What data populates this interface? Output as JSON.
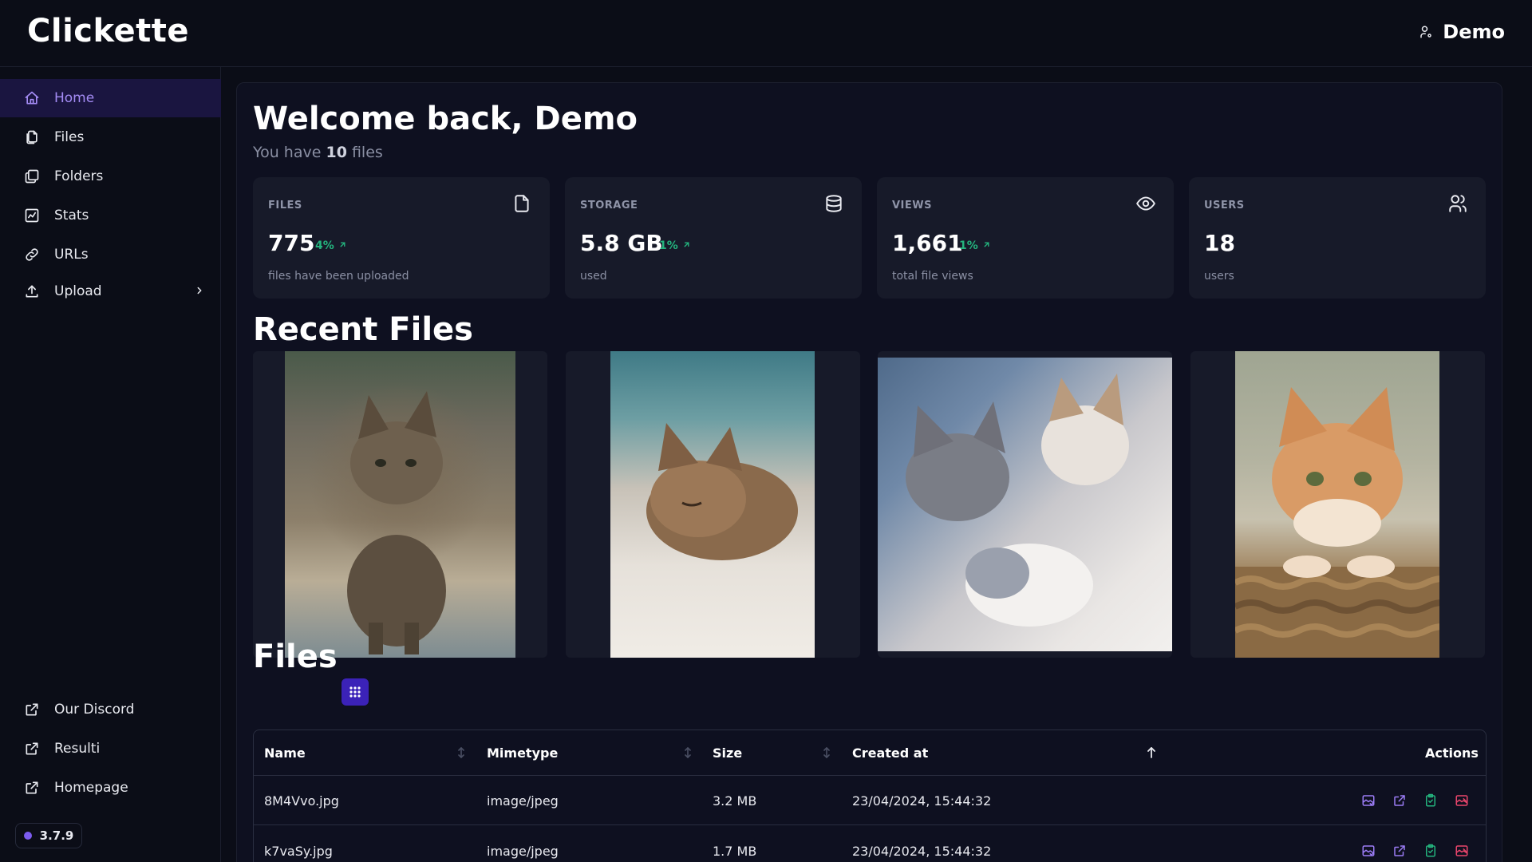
{
  "app": {
    "title": "Clickette"
  },
  "user": {
    "name": "Demo"
  },
  "sidebar": {
    "items": [
      {
        "label": "Home",
        "icon": "home-icon",
        "active": true
      },
      {
        "label": "Files",
        "icon": "files-icon"
      },
      {
        "label": "Folders",
        "icon": "folders-icon"
      },
      {
        "label": "Stats",
        "icon": "stats-icon"
      },
      {
        "label": "URLs",
        "icon": "link-icon"
      },
      {
        "label": "Upload",
        "icon": "upload-icon"
      }
    ],
    "external": [
      {
        "label": "Our Discord",
        "icon": "external-link-icon"
      },
      {
        "label": "Resulti",
        "icon": "external-link-icon"
      },
      {
        "label": "Homepage",
        "icon": "external-link-icon"
      }
    ],
    "version": "3.7.9"
  },
  "welcome": {
    "title": "Welcome back, Demo",
    "sub_prefix": "You have",
    "file_count": "10",
    "sub_suffix": "files"
  },
  "stats": [
    {
      "label": "FILES",
      "value": "775",
      "delta": "4%",
      "desc": "files have been uploaded",
      "icon": "file-icon"
    },
    {
      "label": "STORAGE",
      "value": "5.8 GB",
      "delta": "1%",
      "desc": "used",
      "icon": "database-icon"
    },
    {
      "label": "VIEWS",
      "value": "1,661",
      "delta": "1%",
      "desc": "total file views",
      "icon": "eye-icon"
    },
    {
      "label": "USERS",
      "value": "18",
      "delta": "",
      "desc": "users",
      "icon": "users-icon"
    }
  ],
  "recent": {
    "title": "Recent Files"
  },
  "files": {
    "title": "Files",
    "columns": [
      "Name",
      "Mimetype",
      "Size",
      "Created at",
      "Actions"
    ],
    "rows": [
      {
        "name": "8M4Vvo.jpg",
        "mimetype": "image/jpeg",
        "size": "3.2 MB",
        "created": "23/04/2024, 15:44:32"
      },
      {
        "name": "k7vaSy.jpg",
        "mimetype": "image/jpeg",
        "size": "1.7 MB",
        "created": "23/04/2024, 15:44:32"
      }
    ]
  },
  "colors": {
    "accent": "#7c5cf0",
    "positive": "#24b47e",
    "background": "#0b0d17",
    "card": "#171a29"
  }
}
